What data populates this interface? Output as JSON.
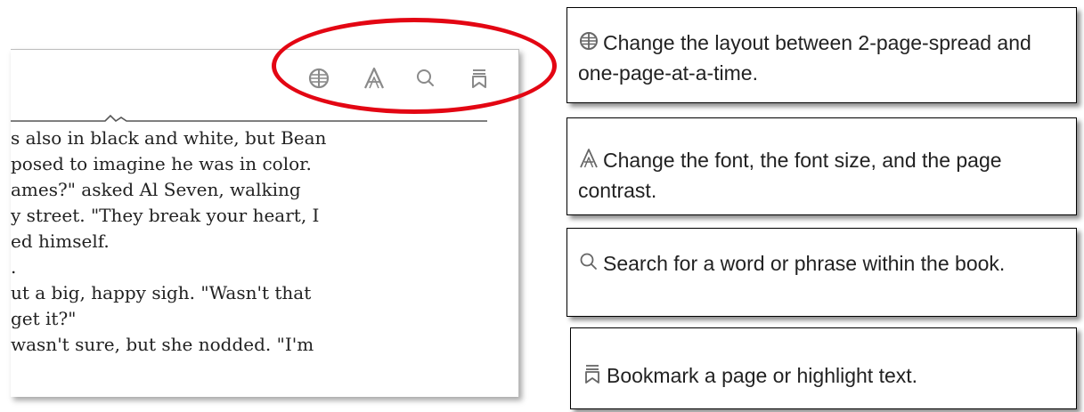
{
  "reader": {
    "toolbar": {
      "icons": [
        "layout-icon",
        "font-icon",
        "search-icon",
        "bookmark-icon"
      ]
    },
    "text_lines": [
      "s also in black and white, but Bean",
      "posed to imagine he was in color.",
      "ames?\" asked Al Seven, walking",
      "y street. \"They break your heart, I",
      "ed himself.",
      ".",
      "ut a big, happy sigh. \"Wasn't that",
      "get it?\"",
      "wasn't sure, but she nodded. \"I'm"
    ]
  },
  "descriptions": [
    {
      "icon": "layout-icon",
      "text": "Change the layout between 2-page-spread and one-page-at-a-time."
    },
    {
      "icon": "font-icon",
      "text": "Change the font, the font size, and the page contrast."
    },
    {
      "icon": "search-icon",
      "text": "Search for a word or phrase within the book."
    },
    {
      "icon": "bookmark-icon",
      "text": "Bookmark a page or highlight text."
    }
  ],
  "colors": {
    "highlight": "#e30613",
    "icon_gray": "#8a8a8a",
    "text": "#222222"
  }
}
